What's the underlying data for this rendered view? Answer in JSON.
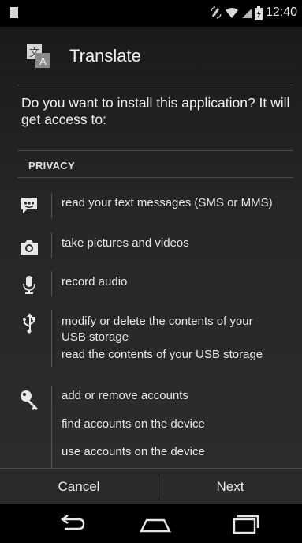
{
  "status_bar": {
    "time": "12:40"
  },
  "app": {
    "title": "Translate",
    "icon_glyphs": [
      "文",
      "A"
    ]
  },
  "prompt": {
    "question": "Do you want to install this application? It will get access to:"
  },
  "section": {
    "label": "PRIVACY"
  },
  "permissions": [
    {
      "icon": "message-icon",
      "lines": [
        "read your text messages (SMS or MMS)"
      ]
    },
    {
      "icon": "camera-icon",
      "lines": [
        "take pictures and videos"
      ]
    },
    {
      "icon": "microphone-icon",
      "lines": [
        "record audio"
      ]
    },
    {
      "icon": "usb-icon",
      "lines": [
        "modify or delete the contents of your",
        "USB storage",
        "read the contents of your USB storage"
      ]
    },
    {
      "icon": "key-icon",
      "lines": [
        "add or remove accounts",
        "find accounts on the device",
        "use accounts on the device"
      ]
    }
  ],
  "buttons": {
    "cancel": "Cancel",
    "next": "Next"
  },
  "navigation": [
    "back-icon",
    "home-icon",
    "recent-apps-icon"
  ],
  "colors": {
    "background": "#2a2a2a",
    "status_bar": "#000000",
    "text": "#e6e6e6"
  }
}
